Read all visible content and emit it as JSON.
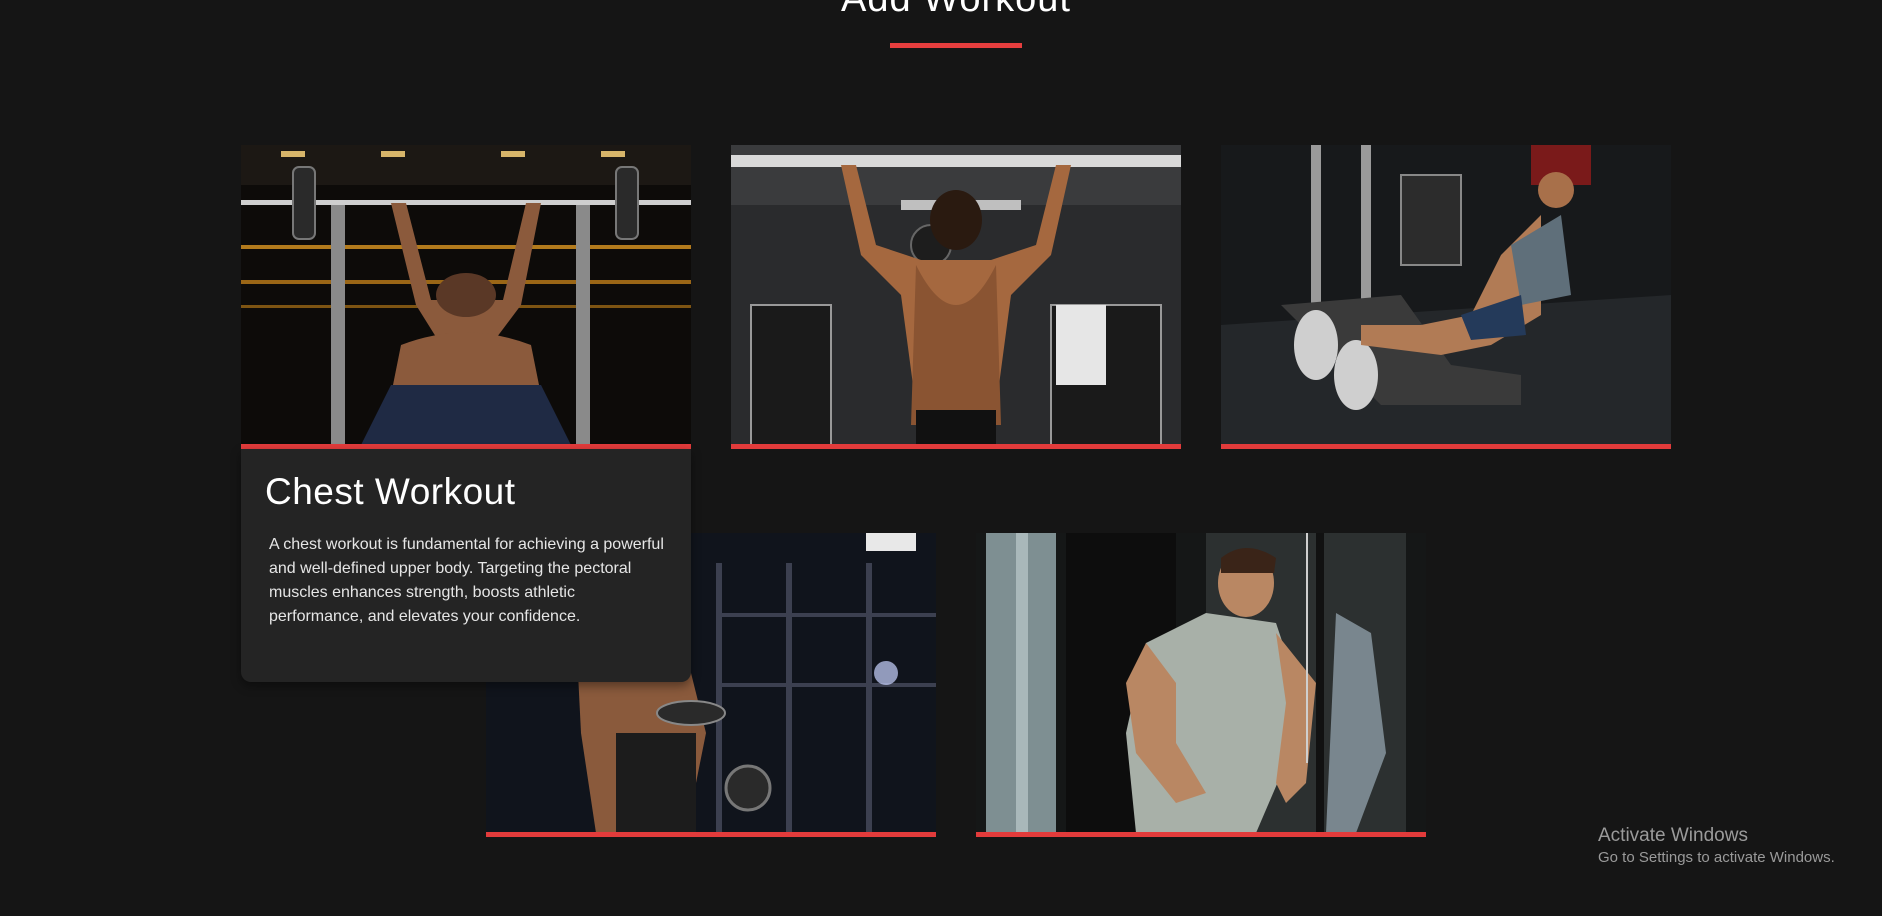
{
  "section": {
    "title": "Add Workout"
  },
  "colors": {
    "background": "#151515",
    "accent": "#e23b3b",
    "panel": "#242424"
  },
  "workouts": [
    {
      "photo_icon": "bench-press-photo"
    },
    {
      "photo_icon": "pull-up-photo"
    },
    {
      "photo_icon": "leg-press-photo"
    },
    {
      "photo_icon": "dumbbell-curl-photo"
    },
    {
      "photo_icon": "cable-triceps-photo"
    }
  ],
  "hover_card": {
    "title": "Chest Workout",
    "description": "A chest workout is fundamental for achieving a powerful and well-defined upper body. Targeting the pectoral muscles enhances strength, boosts athletic performance, and elevates your confidence."
  },
  "os_watermark": {
    "title": "Activate Windows",
    "subtitle": "Go to Settings to activate Windows."
  }
}
